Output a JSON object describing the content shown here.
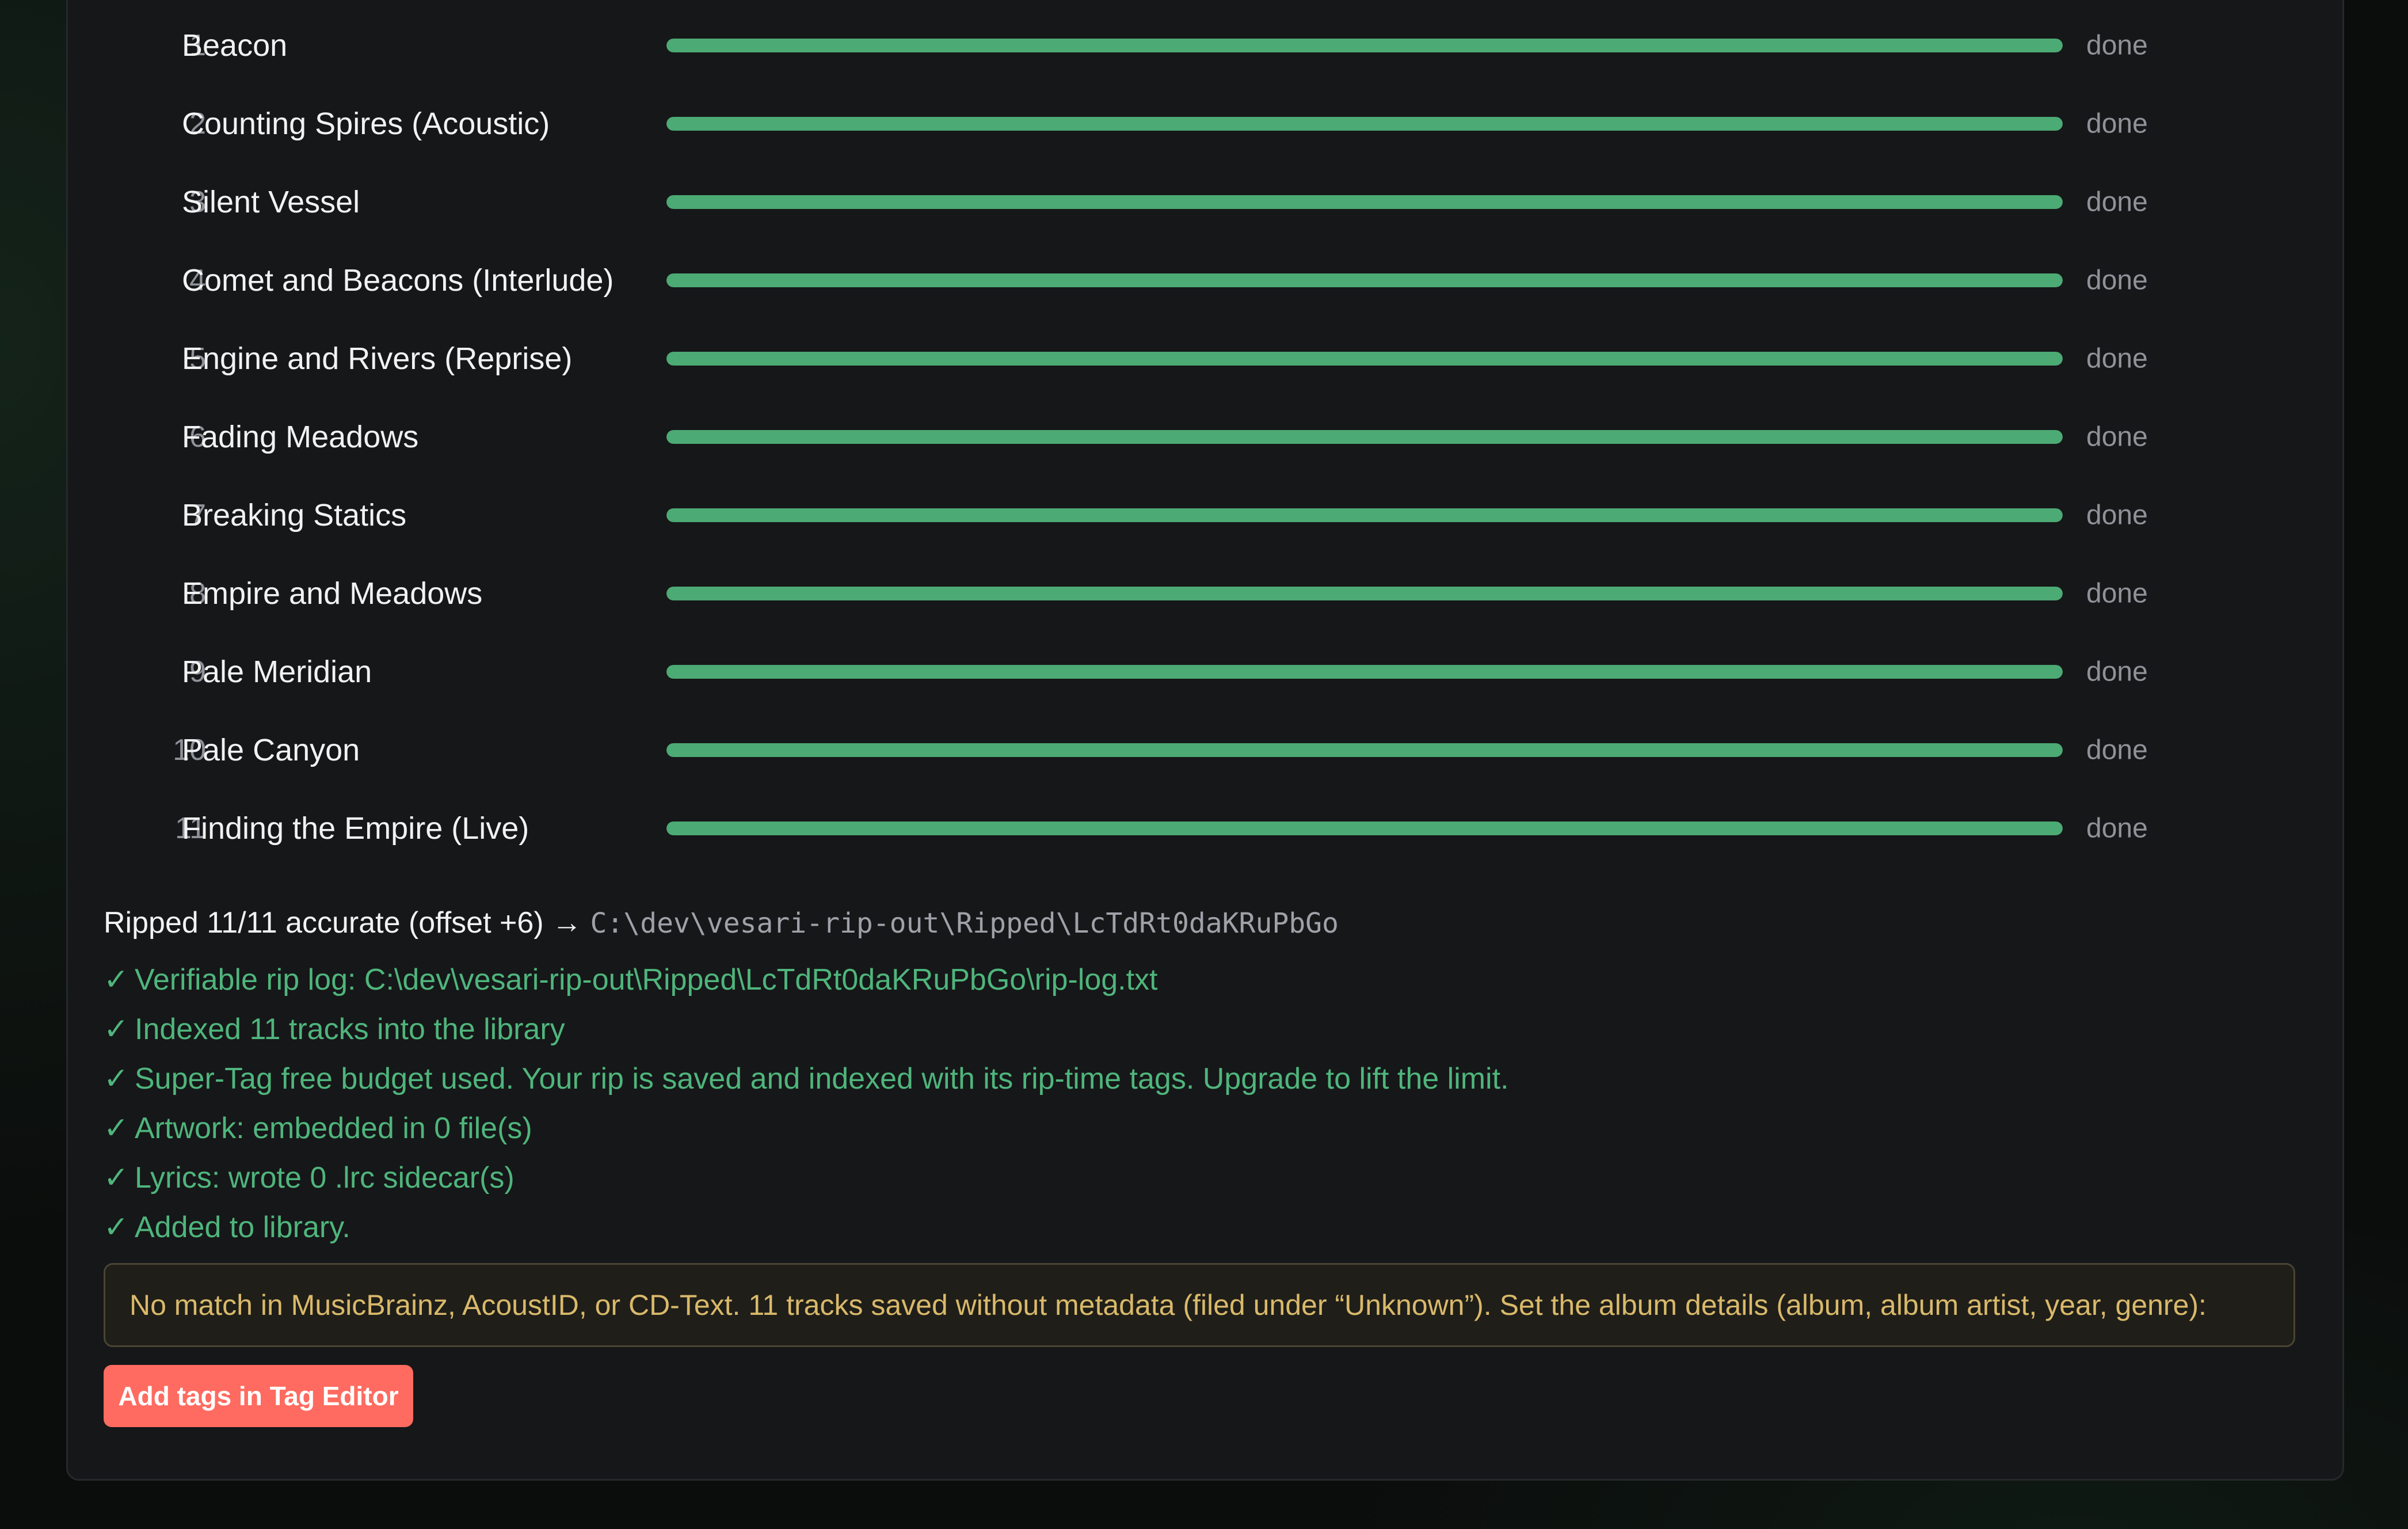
{
  "tracks": [
    {
      "number": "1",
      "title": "Beacon",
      "status": "done",
      "progress": 1.0
    },
    {
      "number": "2",
      "title": "Counting Spires (Acoustic)",
      "status": "done",
      "progress": 1.0
    },
    {
      "number": "3",
      "title": "Silent Vessel",
      "status": "done",
      "progress": 1.0
    },
    {
      "number": "4",
      "title": "Comet and Beacons (Interlude)",
      "status": "done",
      "progress": 1.0
    },
    {
      "number": "5",
      "title": "Engine and Rivers (Reprise)",
      "status": "done",
      "progress": 1.0
    },
    {
      "number": "6",
      "title": "Fading Meadows",
      "status": "done",
      "progress": 1.0
    },
    {
      "number": "7",
      "title": "Breaking Statics",
      "status": "done",
      "progress": 1.0
    },
    {
      "number": "8",
      "title": "Empire and Meadows",
      "status": "done",
      "progress": 1.0
    },
    {
      "number": "9",
      "title": "Pale Meridian",
      "status": "done",
      "progress": 1.0
    },
    {
      "number": "10",
      "title": "Pale Canyon",
      "status": "done",
      "progress": 1.0
    },
    {
      "number": "11",
      "title": "Finding the Empire (Live)",
      "status": "done",
      "progress": 1.0
    }
  ],
  "summary": {
    "text": "Ripped 11/11 accurate (offset +6) →",
    "path": "C:\\dev\\vesari-rip-out\\Ripped\\LcTdRt0daKRuPbGo"
  },
  "log": [
    "Verifiable rip log: C:\\dev\\vesari-rip-out\\Ripped\\LcTdRt0daKRuPbGo\\rip-log.txt",
    "Indexed 11 tracks into the library",
    "Super-Tag free budget used. Your rip is saved and indexed with its rip-time tags. Upgrade to lift the limit.",
    "Artwork: embedded in 0 file(s)",
    "Lyrics: wrote 0 .lrc sidecar(s)",
    "Added to library."
  ],
  "check_glyph": "✓",
  "warning": "No match in MusicBrainz, AcoustID, or CD-Text. 11 tracks saved without metadata (filed under “Unknown”). Set the album details (album, album artist, year, genre):",
  "add_tags_button": "Add tags in Tag Editor",
  "colors": {
    "progress": "#4caa74",
    "success_text": "#4fb57c",
    "warning_text": "#d9b96a",
    "accent_button": "#ff6b60",
    "panel": "#161719"
  }
}
